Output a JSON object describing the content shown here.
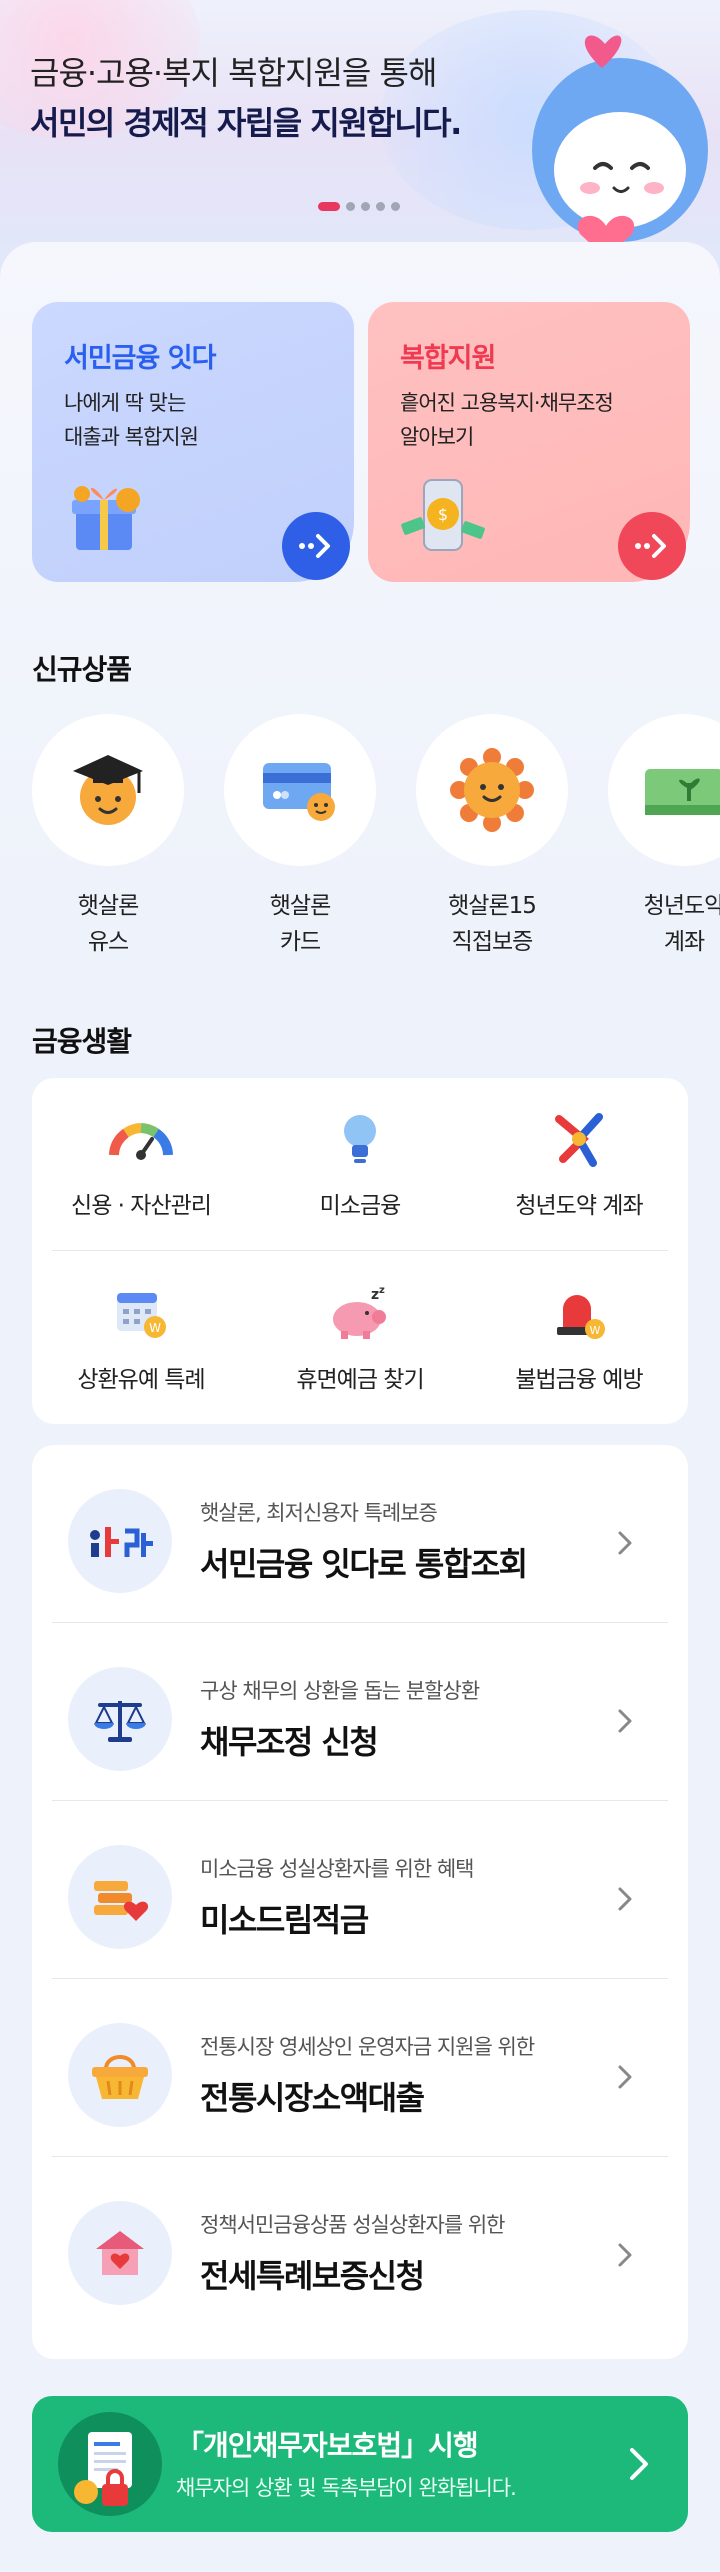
{
  "hero": {
    "subtitle": "금융·고용·복지 복합지원을 통해",
    "title": "서민의 경제적 자립을 지원합니다.",
    "pagination": {
      "active": 1,
      "total": 5
    }
  },
  "promo_cards": [
    {
      "title": "서민금융 잇다",
      "desc_line1": "나에게 딱 맞는",
      "desc_line2": "대출과 복합지원",
      "color": "#2a60f0"
    },
    {
      "title": "복합지원",
      "desc_line1": "흩어진 고용복지·채무조정",
      "desc_line2": "알아보기",
      "color": "#ef3a52"
    }
  ],
  "new_products": {
    "title": "신규상품",
    "items": [
      {
        "label": "햇살론\n유스",
        "icon": "graduation-sun-icon"
      },
      {
        "label": "햇살론\n카드",
        "icon": "card-icon"
      },
      {
        "label": "햇살론15\n직접보증",
        "icon": "sun-icon"
      },
      {
        "label": "청년도약\n계좌",
        "icon": "sprout-icon"
      }
    ]
  },
  "finance_life": {
    "title": "금융생활",
    "items": [
      {
        "label": "신용 · 자산관리",
        "icon": "gauge-icon"
      },
      {
        "label": "미소금융",
        "icon": "lightbulb-icon"
      },
      {
        "label": "청년도약 계좌",
        "icon": "star-figure-icon"
      },
      {
        "label": "상환유예 특례",
        "icon": "calendar-icon"
      },
      {
        "label": "휴면예금 찾기",
        "icon": "piggy-bank-icon"
      },
      {
        "label": "불법금융 예방",
        "icon": "siren-icon"
      }
    ]
  },
  "services": [
    {
      "sub": "햇살론, 최저신용자 특례보증",
      "title": "서민금융 잇다로 통합조회",
      "icon": "itda-logo-icon"
    },
    {
      "sub": "구상 채무의 상환을 돕는 분할상환",
      "title": "채무조정 신청",
      "icon": "scale-icon"
    },
    {
      "sub": "미소금융 성실상환자를 위한 혜택",
      "title": "미소드림적금",
      "icon": "coins-heart-icon"
    },
    {
      "sub": "전통시장 영세상인 운영자금 지원을 위한",
      "title": "전통시장소액대출",
      "icon": "basket-icon"
    },
    {
      "sub": "정책서민금융상품 성실상환자를 위한",
      "title": "전세특례보증신청",
      "icon": "house-heart-icon"
    }
  ],
  "banner": {
    "title": "「개인채무자보호법」시행",
    "desc": "채무자의 상환 및 독촉부담이 완화됩니다.",
    "color": "#1cb97a"
  }
}
